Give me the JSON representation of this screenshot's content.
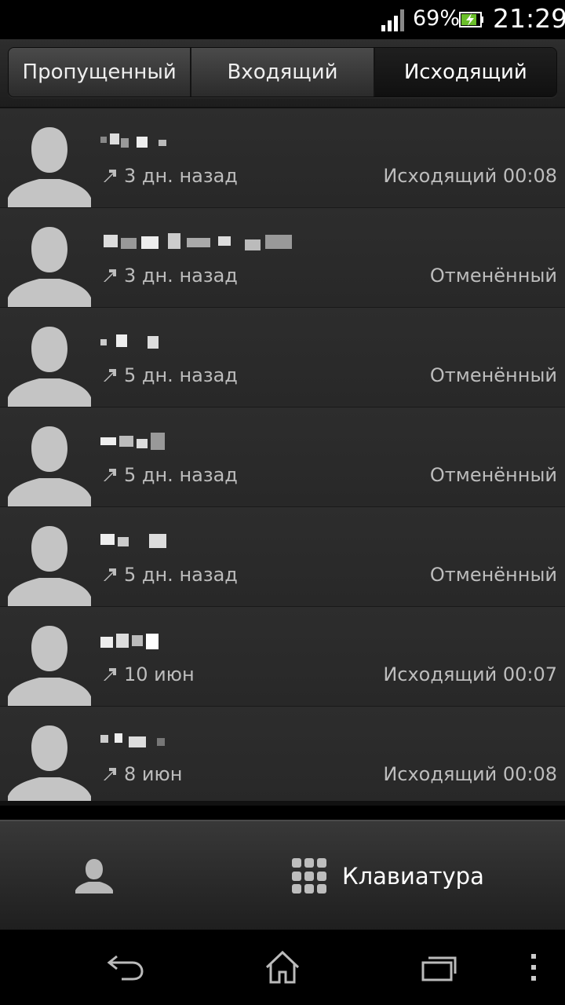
{
  "status_bar": {
    "battery_percent": "69%",
    "time": "21:29",
    "icons": [
      "signal-icon",
      "battery-charging-icon"
    ]
  },
  "tabs": [
    {
      "label": "Пропущенный",
      "active": false
    },
    {
      "label": "Входящий",
      "active": false
    },
    {
      "label": "Исходящий",
      "active": true
    }
  ],
  "calls": [
    {
      "when": "3 дн. назад",
      "status": "Исходящий 00:08"
    },
    {
      "when": "3 дн. назад",
      "status": "Отменённый"
    },
    {
      "when": "5 дн. назад",
      "status": "Отменённый"
    },
    {
      "when": "5 дн. назад",
      "status": "Отменённый"
    },
    {
      "when": "5 дн. назад",
      "status": "Отменённый"
    },
    {
      "when": "10 июн",
      "status": "Исходящий 00:07"
    },
    {
      "when": "8 июн",
      "status": "Исходящий 00:08"
    }
  ],
  "action_bar": {
    "keypad_label": "Клавиатура",
    "icons": [
      "contact-icon",
      "keypad-icon"
    ]
  },
  "nav_bar": {
    "icons": [
      "back-icon",
      "home-icon",
      "recent-apps-icon",
      "menu-icon"
    ]
  },
  "colors": {
    "background": "#2a2a2a",
    "secondary_text": "#bdbdbd",
    "avatar": "#c4c4c4"
  }
}
